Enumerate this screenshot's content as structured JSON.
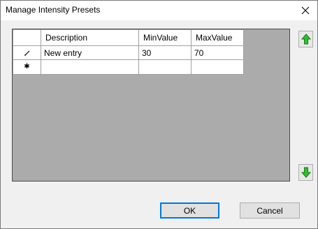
{
  "window": {
    "title": "Manage Intensity Presets"
  },
  "grid": {
    "columns": [
      "Description",
      "MinValue",
      "MaxValue"
    ],
    "rows": [
      {
        "indicator": "edit-pencil-icon",
        "cells": [
          "New entry",
          "30",
          "70"
        ]
      },
      {
        "indicator": "new-row-asterisk-icon",
        "cells": [
          "",
          "",
          ""
        ]
      }
    ]
  },
  "buttons": {
    "ok": "OK",
    "cancel": "Cancel"
  },
  "icons": {
    "close": "close-icon",
    "move_up": "arrow-up-icon",
    "move_down": "arrow-down-icon"
  },
  "colors": {
    "arrow_green": "#2fbf2f",
    "grid_background": "#ababab",
    "default_button_border": "#0078d7"
  }
}
